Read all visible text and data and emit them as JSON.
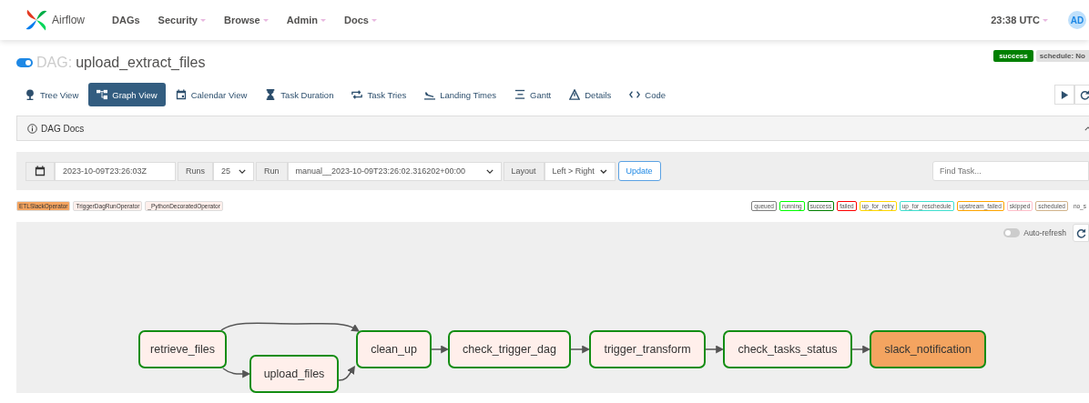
{
  "navbar": {
    "brand": "Airflow",
    "items": [
      {
        "label": "DAGs",
        "has_menu": false
      },
      {
        "label": "Security",
        "has_menu": true
      },
      {
        "label": "Browse",
        "has_menu": true
      },
      {
        "label": "Admin",
        "has_menu": true
      },
      {
        "label": "Docs",
        "has_menu": true
      }
    ],
    "clock": "23:38 UTC",
    "user_initials": "AD"
  },
  "dag": {
    "paused_toggle_on": true,
    "prefix": "DAG:",
    "name": "upload_extract_files",
    "status_badge": "success",
    "schedule_badge": "schedule: No"
  },
  "view_tabs": [
    {
      "label": "Tree View",
      "selected": false
    },
    {
      "label": "Graph View",
      "selected": true
    },
    {
      "label": "Calendar View",
      "selected": false
    },
    {
      "label": "Task Duration",
      "selected": false
    },
    {
      "label": "Task Tries",
      "selected": false
    },
    {
      "label": "Landing Times",
      "selected": false
    },
    {
      "label": "Gantt",
      "selected": false
    },
    {
      "label": "Details",
      "selected": false
    },
    {
      "label": "Code",
      "selected": false
    }
  ],
  "dag_docs": {
    "title": "DAG Docs"
  },
  "filters": {
    "base_date": "2023-10-09T23:26:03Z",
    "runs_label": "Runs",
    "runs_value": "25",
    "run_label": "Run",
    "run_value": "manual__2023-10-09T23:26:02.316202+00:00",
    "layout_label": "Layout",
    "layout_value": "Left > Right",
    "update_button": "Update",
    "find_task_placeholder": "Find Task..."
  },
  "operator_legend": [
    {
      "label": "ETLSlackOperator",
      "color": "#f4a460"
    },
    {
      "label": "TriggerDagRunOperator",
      "color": "#ffefeb"
    },
    {
      "label": "_PythonDecoratedOperator",
      "color": "#ffefeb"
    }
  ],
  "state_legend": [
    {
      "label": "queued",
      "color": "#808080"
    },
    {
      "label": "running",
      "color": "#00ff00"
    },
    {
      "label": "success",
      "color": "#008000"
    },
    {
      "label": "failed",
      "color": "#ff0000"
    },
    {
      "label": "up_for_retry",
      "color": "#ffd700"
    },
    {
      "label": "up_for_reschedule",
      "color": "#40e0d0"
    },
    {
      "label": "upstream_failed",
      "color": "#ffa500"
    },
    {
      "label": "skipped",
      "color": "#ffc0cb"
    },
    {
      "label": "scheduled",
      "color": "#d2b48c"
    },
    {
      "label": "no_s",
      "color": "#ffffff"
    }
  ],
  "graph": {
    "auto_refresh_label": "Auto-refresh",
    "auto_refresh_on": false,
    "nodes": [
      {
        "label": "retrieve_files",
        "color": "#ffefeb"
      },
      {
        "label": "upload_files",
        "color": "#ffefeb"
      },
      {
        "label": "clean_up",
        "color": "#ffefeb"
      },
      {
        "label": "check_trigger_dag",
        "color": "#ffefeb"
      },
      {
        "label": "trigger_transform",
        "color": "#ffefeb"
      },
      {
        "label": "check_tasks_status",
        "color": "#ffefeb"
      },
      {
        "label": "slack_notification",
        "color": "#f4a460"
      }
    ]
  }
}
